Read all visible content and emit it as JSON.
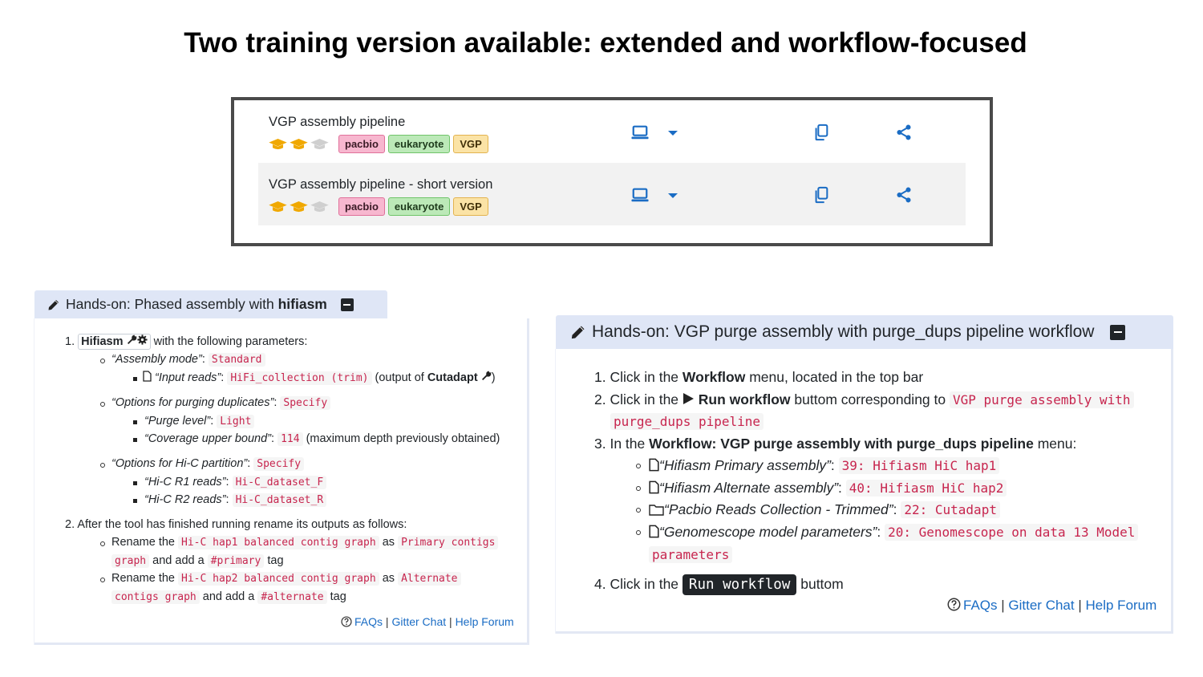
{
  "slide": {
    "title": "Two training version available: extended and workflow-focused"
  },
  "tutorials": [
    {
      "name": "VGP assembly pipeline",
      "tags": [
        "pacbio",
        "eukaryote",
        "VGP"
      ],
      "level": 2,
      "level_max": 3
    },
    {
      "name": "VGP assembly pipeline - short version",
      "tags": [
        "pacbio",
        "eukaryote",
        "VGP"
      ],
      "level": 2,
      "level_max": 3
    }
  ],
  "colors": {
    "hat_active": "#f0a800",
    "hat_inactive": "#cfcfcf",
    "icon_blue": "#1a6cc4",
    "hands_on_header": "#dfe6f6"
  },
  "icons": {
    "laptop": "laptop-icon",
    "caret": "caret-down-icon",
    "copy": "copy-icon",
    "share": "share-icon",
    "pencil": "pencil-icon",
    "collapse": "minus-square-icon",
    "file": "file-icon",
    "folder": "folder-icon",
    "wrench": "wrench-icon",
    "gear": "gear-icon",
    "play": "play-icon",
    "help": "question-circle-icon"
  },
  "left": {
    "header_prefix": "Hands-on: Phased assembly with",
    "header_tool": "hifiasm",
    "s1_num": "1.",
    "s1_tool": "Hifiasm",
    "s1_text": "with the following parameters:",
    "p1_label": "“Assembly mode”",
    "p1_value": "Standard",
    "p1a_label": "“Input reads”",
    "p1a_value": "HiFi_collection (trim)",
    "p1a_note_pre": "(output of",
    "p1a_note_tool": "Cutadapt",
    "p1a_note_post": ")",
    "p2_label": "“Options for purging duplicates”",
    "p2_value": "Specify",
    "p2a_label": "“Purge level”",
    "p2a_value": "Light",
    "p2b_label": "“Coverage upper bound”",
    "p2b_value": "114",
    "p2b_note": "(maximum depth previously obtained)",
    "p3_label": "“Options for Hi-C partition”",
    "p3_value": "Specify",
    "p3a_label": "“Hi-C R1 reads”",
    "p3a_value": "Hi-C_dataset_F",
    "p3b_label": "“Hi-C R2 reads”",
    "p3b_value": "Hi-C_dataset_R",
    "colon": ":",
    "s2": "2. After the tool has finished running rename its outputs as follows:",
    "r1_pre": "Rename the",
    "r1_from": "Hi-C hap1 balanced contig graph",
    "r1_as": "as",
    "r1_to_a": "Primary contigs",
    "r1_to_b": "graph",
    "r1_add": "and add a",
    "r1_tag": "#primary",
    "r1_tagw": "tag",
    "r2_pre": "Rename the",
    "r2_from": "Hi-C hap2 balanced contig graph",
    "r2_as": "as",
    "r2_to_a": "Alternate",
    "r2_to_b": "contigs graph",
    "r2_add": "and add a",
    "r2_tag": "#alternate",
    "r2_tagw": "tag",
    "faqs": "FAQs",
    "gitter": "Gitter Chat",
    "forum": "Help Forum",
    "sep": "|"
  },
  "right": {
    "header": "Hands-on: VGP purge assembly with purge_dups pipeline workflow",
    "s1_pre": "1. Click in the",
    "s1_b": "Workflow",
    "s1_post": "menu, located in the top bar",
    "s2_pre": "2. Click in the",
    "s2_b": "Run workflow",
    "s2_mid": "buttom corresponding to",
    "s2_code_a": "VGP purge assembly with",
    "s2_code_b": "purge_dups pipeline",
    "s3_pre": "3. In the",
    "s3_b": "Workflow: VGP purge assembly with purge_dups pipeline",
    "s3_post": "menu:",
    "i1_label": "“Hifiasm Primary assembly”",
    "i1_value": "39: Hifiasm HiC hap1",
    "i2_label": "“Hifiasm Alternate assembly”",
    "i2_value": "40: Hifiasm HiC hap2",
    "i3_label": "“Pacbio Reads Collection - Trimmed”",
    "i3_value": "22: Cutadapt",
    "i4_label": "“Genomescope model parameters”",
    "i4_value_a": "20: Genomescope on data 13 Model",
    "i4_value_b": "parameters",
    "colon": ":",
    "s4_pre": "4. Click in the",
    "s4_code": "Run workflow",
    "s4_post": "buttom",
    "faqs": "FAQs",
    "gitter": "Gitter Chat",
    "forum": "Help Forum",
    "sep": "|"
  }
}
